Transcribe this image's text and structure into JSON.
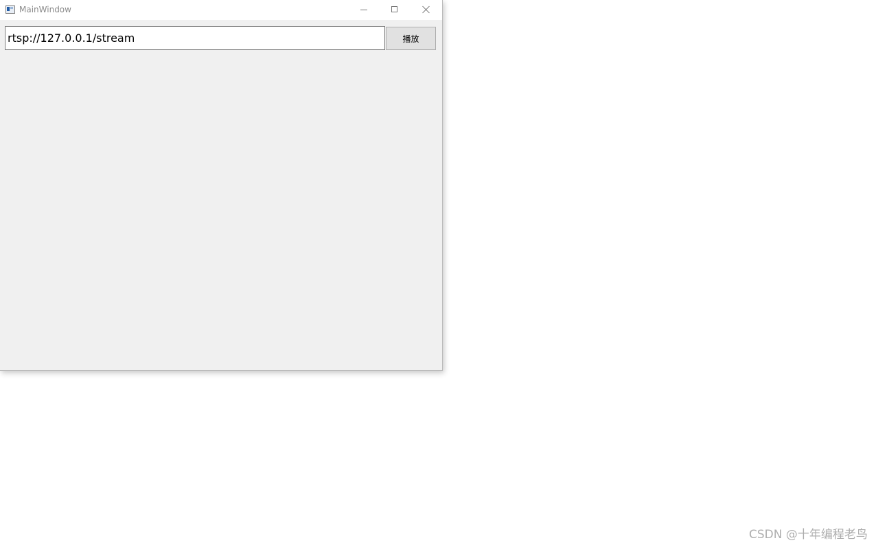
{
  "window": {
    "title": "MainWindow",
    "icon": "app-window-icon",
    "controls": {
      "minimize_icon": "minimize-icon",
      "maximize_icon": "maximize-icon",
      "close_icon": "close-icon"
    }
  },
  "toolbar": {
    "url_value": "rtsp://127.0.0.1/stream",
    "play_label": "播放"
  },
  "watermark": {
    "text": "CSDN @十年编程老鸟"
  }
}
